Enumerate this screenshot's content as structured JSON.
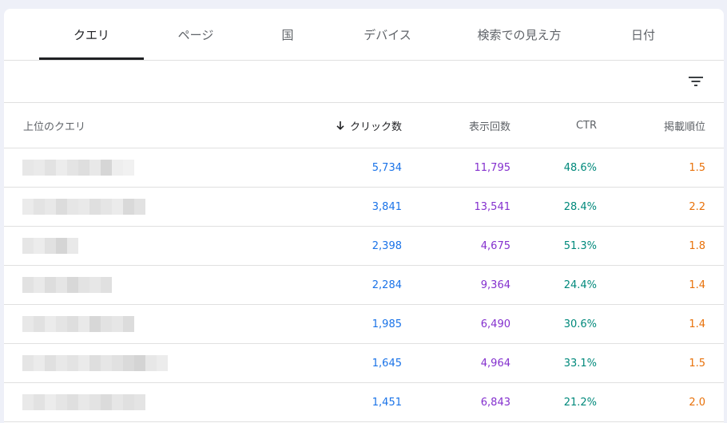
{
  "colors": {
    "clicks": "#1a73e8",
    "impressions": "#8430ce",
    "ctr": "#00897b",
    "position": "#e8710a"
  },
  "tabs": [
    {
      "label": "クエリ",
      "active": true
    },
    {
      "label": "ページ",
      "active": false
    },
    {
      "label": "国",
      "active": false
    },
    {
      "label": "デバイス",
      "active": false
    },
    {
      "label": "検索での見え方",
      "active": false
    },
    {
      "label": "日付",
      "active": false
    }
  ],
  "toolbar": {
    "filter_icon": "filter-list-icon"
  },
  "table": {
    "headers": {
      "query": "上位のクエリ",
      "clicks": "クリック数",
      "impressions": "表示回数",
      "ctr": "CTR",
      "position": "掲載順位"
    },
    "sort_icon": "arrow-down-icon",
    "rows": [
      {
        "clicks": "5,734",
        "impressions": "11,795",
        "ctr": "48.6%",
        "position": "1.5"
      },
      {
        "clicks": "3,841",
        "impressions": "13,541",
        "ctr": "28.4%",
        "position": "2.2"
      },
      {
        "clicks": "2,398",
        "impressions": "4,675",
        "ctr": "51.3%",
        "position": "1.8"
      },
      {
        "clicks": "2,284",
        "impressions": "9,364",
        "ctr": "24.4%",
        "position": "1.4"
      },
      {
        "clicks": "1,985",
        "impressions": "6,490",
        "ctr": "30.6%",
        "position": "1.4"
      },
      {
        "clicks": "1,645",
        "impressions": "4,964",
        "ctr": "33.1%",
        "position": "1.5"
      },
      {
        "clicks": "1,451",
        "impressions": "6,843",
        "ctr": "21.2%",
        "position": "2.0"
      }
    ]
  }
}
